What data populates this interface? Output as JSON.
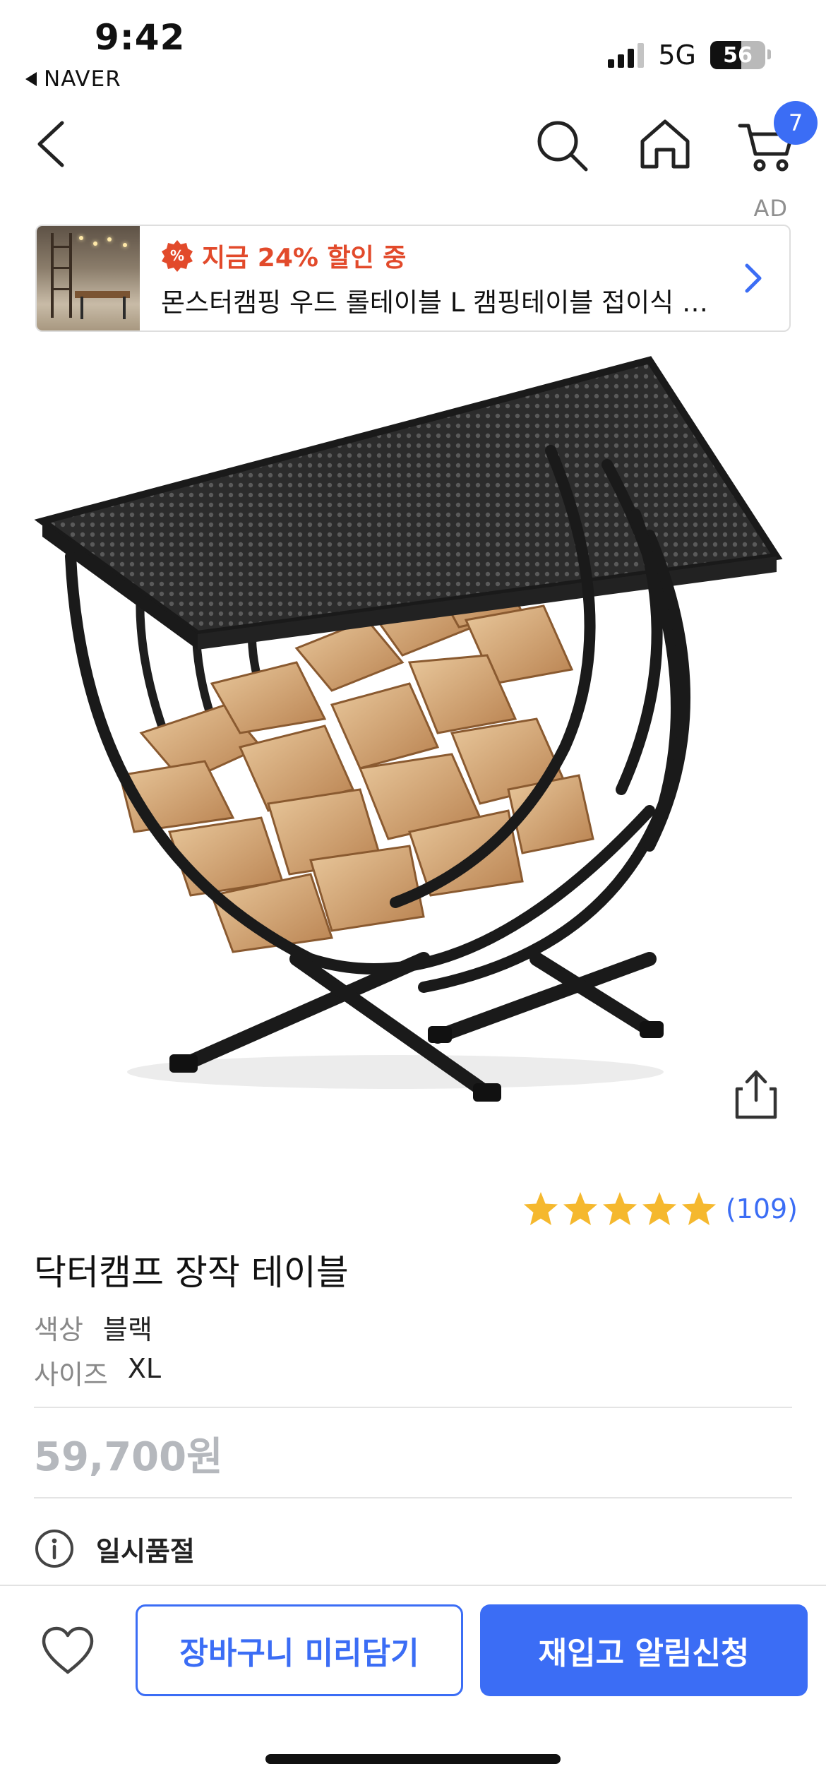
{
  "status_bar": {
    "time": "9:42",
    "back_app": "NAVER",
    "network": "5G",
    "battery": "56"
  },
  "nav": {
    "cart_count": "7",
    "icons": [
      "back-chevron-icon",
      "search-icon",
      "home-icon",
      "cart-icon"
    ]
  },
  "ad": {
    "label": "AD",
    "promo": "지금 24% 할인 중",
    "badge_icon": "percent-badge-icon",
    "title": "몬스터캠핑 우드 롤테이블 L 캠핑테이블 접이식 원목 테이블"
  },
  "product": {
    "rating_stars": 5,
    "rating_count": "(109)",
    "title": "닥터캠프 장작 테이블",
    "options": [
      {
        "key": "색상",
        "value": "블랙"
      },
      {
        "key": "사이즈",
        "value": "XL"
      }
    ],
    "price": "59,700원",
    "status": "일시품절"
  },
  "actions": {
    "cart_button": "장바구니 미리담기",
    "restock_button": "재입고 알림신청"
  },
  "colors": {
    "accent": "#3b6df5",
    "promo": "#e24a2b",
    "star": "#f5b82e",
    "muted_price": "#b5b8bd"
  }
}
